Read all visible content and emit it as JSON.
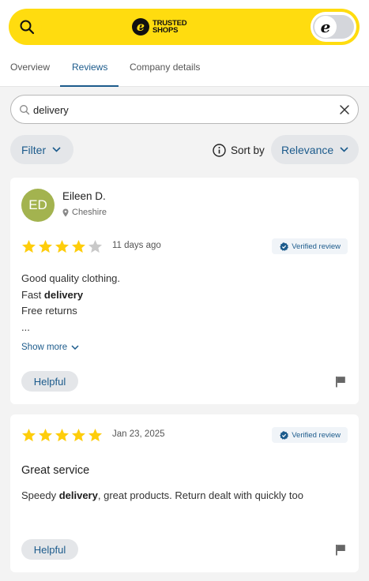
{
  "header": {
    "logo_line1": "TRUSTED",
    "logo_line2": "SHOPS",
    "logo_mark": "e",
    "toggle_mark": "e",
    "accent_yellow": "#ffdc0f"
  },
  "tabs": [
    {
      "label": "Overview",
      "active": false
    },
    {
      "label": "Reviews",
      "active": true
    },
    {
      "label": "Company details",
      "active": false
    }
  ],
  "search": {
    "value": "delivery",
    "icon": "search-icon",
    "clear_icon": "close-icon"
  },
  "controls": {
    "filter_label": "Filter",
    "sort_label": "Sort by",
    "sort_value": "Relevance",
    "accent_blue": "#1c5b8c"
  },
  "reviews": [
    {
      "initials": "ED",
      "name": "Eileen D.",
      "location": "Cheshire",
      "rating": 4,
      "max_rating": 5,
      "date": "11 days ago",
      "verified_label": "Verified review",
      "line1": "Good quality clothing.",
      "line2_prefix": "Fast ",
      "line2_bold": "delivery",
      "line3": "Free returns",
      "line4": "...",
      "show_more": "Show more",
      "helpful": "Helpful",
      "avatar_color": "#a3b34f"
    },
    {
      "rating": 5,
      "max_rating": 5,
      "date": "Jan 23, 2025",
      "verified_label": "Verified review",
      "title": "Great service",
      "text_prefix": "Speedy ",
      "text_bold": "delivery",
      "text_suffix": ", great products. Return dealt with quickly too",
      "helpful": "Helpful"
    }
  ]
}
